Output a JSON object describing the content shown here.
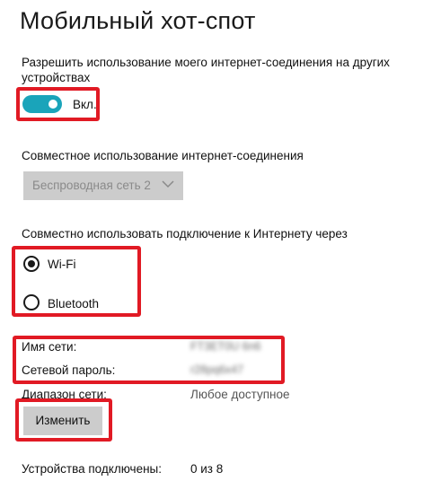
{
  "page": {
    "title": "Мобильный хот-спот"
  },
  "share_setting": {
    "description": "Разрешить использование моего интернет-соединения на других устройствах",
    "toggle_state": "Вкл."
  },
  "connection_share": {
    "label": "Совместное использование интернет-соединения",
    "dropdown_value": "Беспроводная сеть 2"
  },
  "share_via": {
    "label": "Совместно использовать подключение к Интернету через",
    "options": [
      {
        "label": "Wi-Fi",
        "selected": true
      },
      {
        "label": "Bluetooth",
        "selected": false
      }
    ]
  },
  "network": {
    "name_label": "Имя сети:",
    "name_value": "FT3ET0U 6n6",
    "password_label": "Сетевой пароль:",
    "password_value": "r28pq6x47",
    "range_label": "Диапазон сети:",
    "range_value": "Любое доступное",
    "edit_button": "Изменить"
  },
  "devices": {
    "label": "Устройства подключены:",
    "value": "0 из 8"
  },
  "colors": {
    "accent": "#1aa4ba",
    "highlight": "#e11a24",
    "disabled_bg": "#cccccc"
  },
  "icons": {
    "dropdown": "chevron-down-icon"
  }
}
